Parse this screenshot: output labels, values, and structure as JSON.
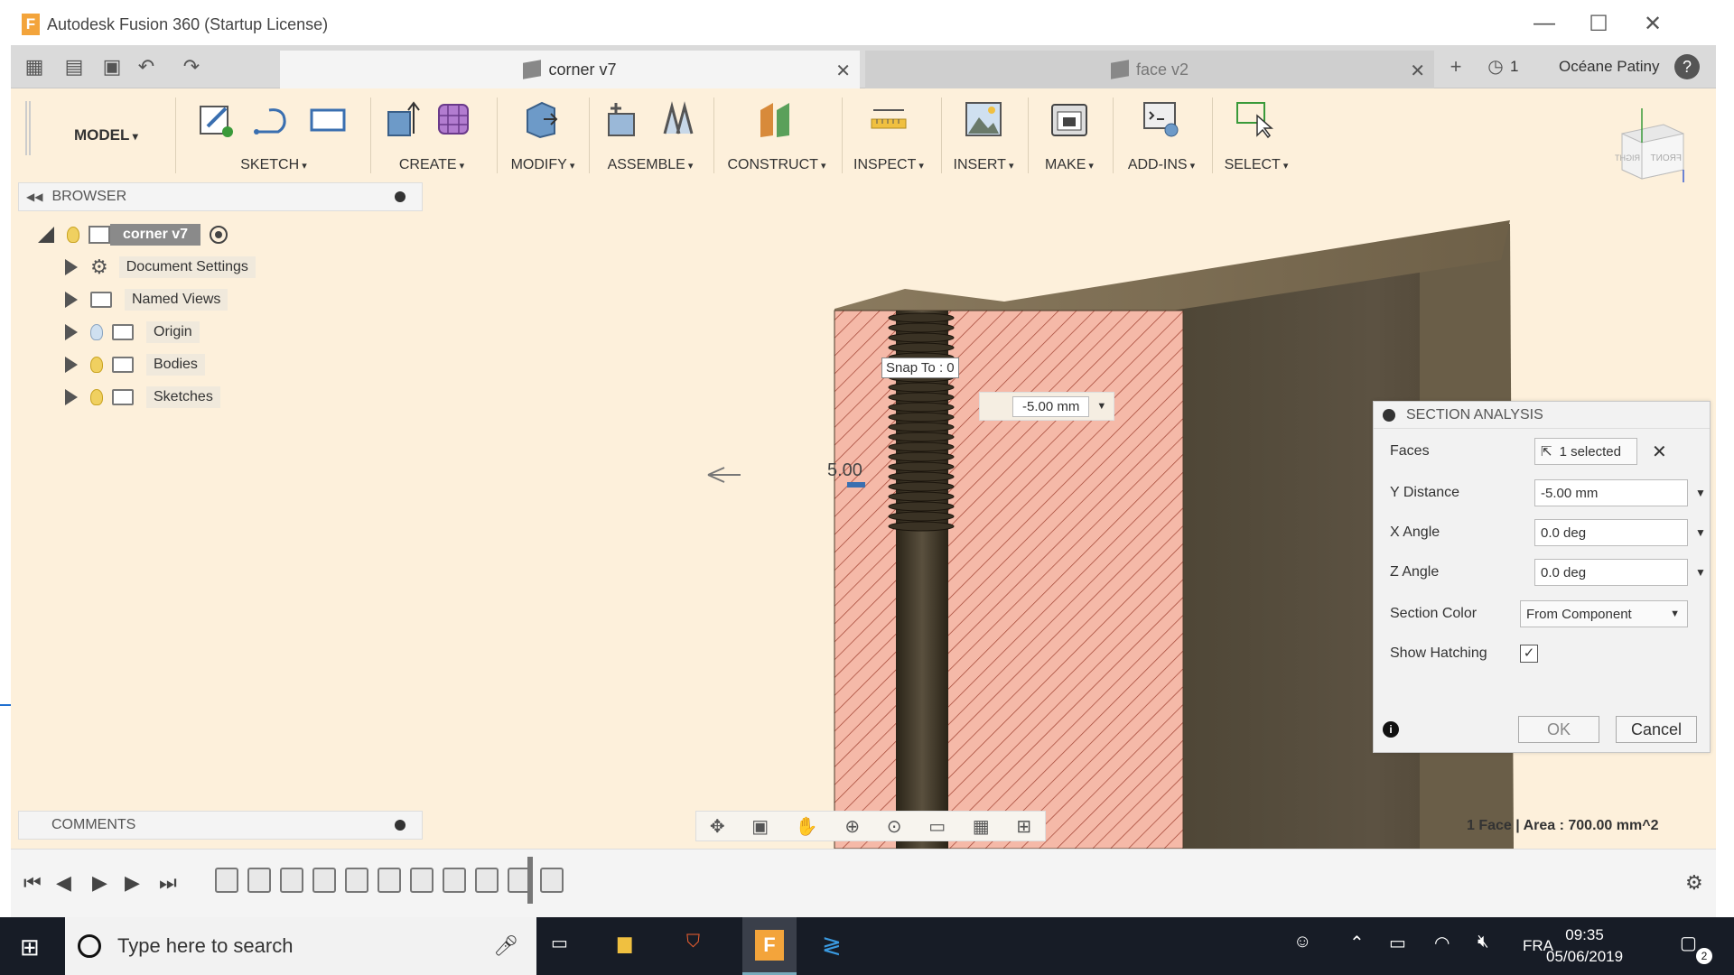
{
  "window": {
    "title": "Autodesk Fusion 360 (Startup License)",
    "minimize": "—",
    "maximize": "☐",
    "close": "✕"
  },
  "tabs": [
    {
      "label": "corner v7",
      "close": "✕"
    },
    {
      "label": "face v2",
      "close": "✕"
    }
  ],
  "header": {
    "jobs_count": "1",
    "user": "Océane Patiny",
    "help": "?"
  },
  "toolbar": {
    "workspace": "MODEL",
    "groups": [
      "SKETCH",
      "CREATE",
      "MODIFY",
      "ASSEMBLE",
      "CONSTRUCT",
      "INSPECT",
      "INSERT",
      "MAKE",
      "ADD-INS",
      "SELECT"
    ]
  },
  "browser": {
    "title": "BROWSER",
    "root": "corner v7",
    "items": [
      "Document Settings",
      "Named Views",
      "Origin",
      "Bodies",
      "Sketches"
    ]
  },
  "comments": {
    "title": "COMMENTS"
  },
  "viewport": {
    "snap_label": "Snap To : 0",
    "dim_input": "-5.00 mm",
    "dim_text": "5.00",
    "status": "1 Face | Area : 700.00 mm^2",
    "viewcube_front": "FRONT",
    "viewcube_right": "RIGHT"
  },
  "section_panel": {
    "title": "SECTION ANALYSIS",
    "faces_label": "Faces",
    "faces_value": "1 selected",
    "y_distance_label": "Y Distance",
    "y_distance_value": "-5.00 mm",
    "x_angle_label": "X Angle",
    "x_angle_value": "0.0 deg",
    "z_angle_label": "Z Angle",
    "z_angle_value": "0.0 deg",
    "section_color_label": "Section Color",
    "section_color_value": "From Component",
    "show_hatching_label": "Show Hatching",
    "show_hatching": true,
    "ok": "OK",
    "cancel": "Cancel"
  },
  "taskbar": {
    "search_placeholder": "Type here to search",
    "language": "FRA",
    "time": "09:35",
    "date": "05/06/2019",
    "notifications": "2"
  },
  "colors": {
    "section_fill": "#f5b9a8",
    "hatch": "#a04030",
    "body": "#5a5040",
    "accent_orange": "#f3a43b"
  }
}
